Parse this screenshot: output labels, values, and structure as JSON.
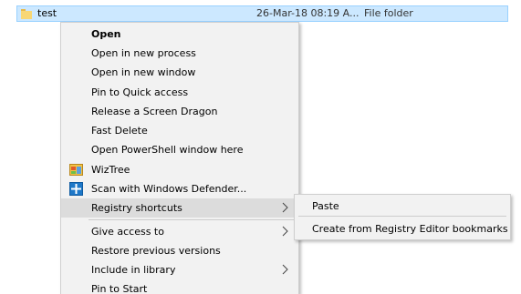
{
  "file_row": {
    "name": "test",
    "date": "26-Mar-18 08:19 A...",
    "type": "File folder"
  },
  "context_menu": {
    "items": [
      {
        "label": "Open"
      },
      {
        "label": "Open in new process"
      },
      {
        "label": "Open in new window"
      },
      {
        "label": "Pin to Quick access"
      },
      {
        "label": "Release a Screen Dragon"
      },
      {
        "label": "Fast Delete"
      },
      {
        "label": "Open PowerShell window here"
      },
      {
        "label": "WizTree",
        "icon": "wiztree-icon"
      },
      {
        "label": "Scan with Windows Defender...",
        "icon": "windows-defender-icon"
      },
      {
        "label": "Registry shortcuts",
        "has_submenu": true,
        "highlighted": true
      },
      {
        "label": "Give access to",
        "has_submenu": true
      },
      {
        "label": "Restore previous versions"
      },
      {
        "label": "Include in library",
        "has_submenu": true
      },
      {
        "label": "Pin to Start"
      }
    ]
  },
  "submenu": {
    "items": [
      {
        "label": "Paste"
      },
      {
        "label": "Create from Registry Editor bookmarks"
      }
    ]
  },
  "colors": {
    "selection": "#cce8ff",
    "menu_background": "#f2f2f2",
    "menu_highlight": "#dcdcdc"
  }
}
